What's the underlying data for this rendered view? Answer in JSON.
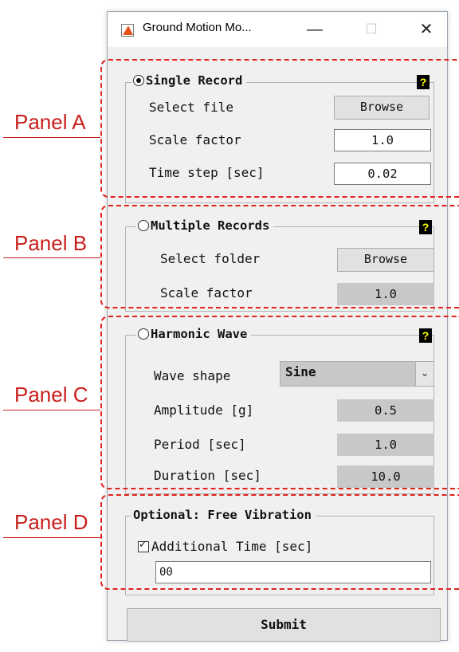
{
  "window": {
    "title": "Ground Motion Mo...",
    "minimize_glyph": "—",
    "maximize_glyph": "☐",
    "close_glyph": "✕",
    "icon": "matlab-icon"
  },
  "panel_a": {
    "title": "Single Record",
    "radio_selected": true,
    "help_label": "?",
    "select_file_label": "Select file",
    "browse_label": "Browse",
    "scale_factor_label": "Scale factor",
    "scale_factor_value": "1.0",
    "time_step_label": "Time step [sec]",
    "time_step_value": "0.02"
  },
  "panel_b": {
    "title": "Multiple Records",
    "radio_selected": false,
    "help_label": "?",
    "select_folder_label": "Select folder",
    "browse_label": "Browse",
    "scale_factor_label": "Scale factor",
    "scale_factor_value": "1.0"
  },
  "panel_c": {
    "title": "Harmonic Wave",
    "radio_selected": false,
    "help_label": "?",
    "wave_shape_label": "Wave shape",
    "wave_shape_value": "Sine",
    "amplitude_label": "Amplitude [g]",
    "amplitude_value": "0.5",
    "period_label": "Period [sec]",
    "period_value": "1.0",
    "duration_label": "Duration [sec]",
    "duration_value": "10.0"
  },
  "panel_d": {
    "title": "Optional: Free Vibration",
    "checkbox_checked": true,
    "checkbox_label": "Additional Time [sec]",
    "additional_time_value": "00"
  },
  "submit_label": "Submit",
  "annotations": {
    "panel_a": "Panel A",
    "panel_b": "Panel B",
    "panel_c": "Panel C",
    "panel_d": "Panel D",
    "color": "#c81e1a"
  }
}
